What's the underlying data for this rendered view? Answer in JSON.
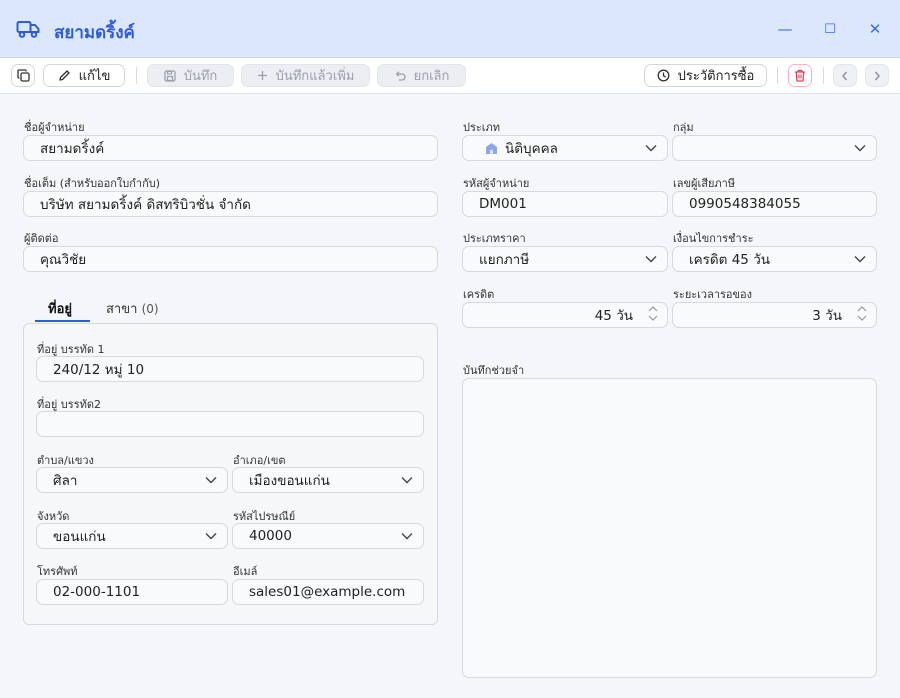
{
  "window": {
    "title": "สยามดริ้งค์",
    "controls": {
      "minimize": "—",
      "maximize": "☐",
      "close": "✕"
    }
  },
  "toolbar": {
    "edit_label": "แก้ไข",
    "save_label": "บันทึก",
    "save_new_label": "บันทึกแล้วเพิ่ม",
    "cancel_label": "ยกเลิก",
    "history_label": "ประวัติการซื้อ"
  },
  "form": {
    "vendor_name": {
      "label": "ชื่อผู้จำหน่าย",
      "value": "สยามดริ้งค์"
    },
    "full_name": {
      "label": "ชื่อเต็ม (สำหรับออกใบกำกับ)",
      "value": "บริษัท สยามดริ้งค์ ดิสทริบิวชั่น จำกัด"
    },
    "contact": {
      "label": "ผู้ติดต่อ",
      "value": "คุณวิชัย"
    },
    "type": {
      "label": "ประเภท",
      "value": "นิติบุคคล"
    },
    "group": {
      "label": "กลุ่ม",
      "value": ""
    },
    "vendor_code": {
      "label": "รหัสผู้จำหน่าย",
      "value": "DM001"
    },
    "tax_id": {
      "label": "เลขผู้เสียภาษี",
      "value": "0990548384055"
    },
    "price_type": {
      "label": "ประเภทราคา",
      "value": "แยกภาษี"
    },
    "payment_terms": {
      "label": "เงื่อนไขการชำระ",
      "value": "เครดิต 45 วัน"
    },
    "credit": {
      "label": "เครดิต",
      "value": "45 วัน"
    },
    "lead_time": {
      "label": "ระยะเวลารอของ",
      "value": "3 วัน"
    },
    "memo": {
      "label": "บันทึกช่วยจำ",
      "value": ""
    }
  },
  "tabs": [
    {
      "label": "ที่อยู่",
      "count": ""
    },
    {
      "label": "สาขา",
      "count": "(0)"
    }
  ],
  "address": {
    "line1": {
      "label": "ที่อยู่ บรรทัด 1",
      "value": "240/12 หมู่ 10"
    },
    "line2": {
      "label": "ที่อยู่ บรรทัด2",
      "value": ""
    },
    "subdistrict": {
      "label": "ตำบล/แขวง",
      "value": "ศิลา"
    },
    "district": {
      "label": "อำเภอ/เขต",
      "value": "เมืองขอนแก่น"
    },
    "province": {
      "label": "จังหวัด",
      "value": "ขอนแก่น"
    },
    "postcode": {
      "label": "รหัสไปรษณีย์",
      "value": "40000"
    },
    "phone": {
      "label": "โทรศัพท์",
      "value": "02-000-1101"
    },
    "email": {
      "label": "อีเมล์",
      "value": "sales01@example.com"
    }
  },
  "colors": {
    "accent": "#2f5bd8",
    "titlebar": "#dbe7fb",
    "danger": "#e0405a"
  }
}
